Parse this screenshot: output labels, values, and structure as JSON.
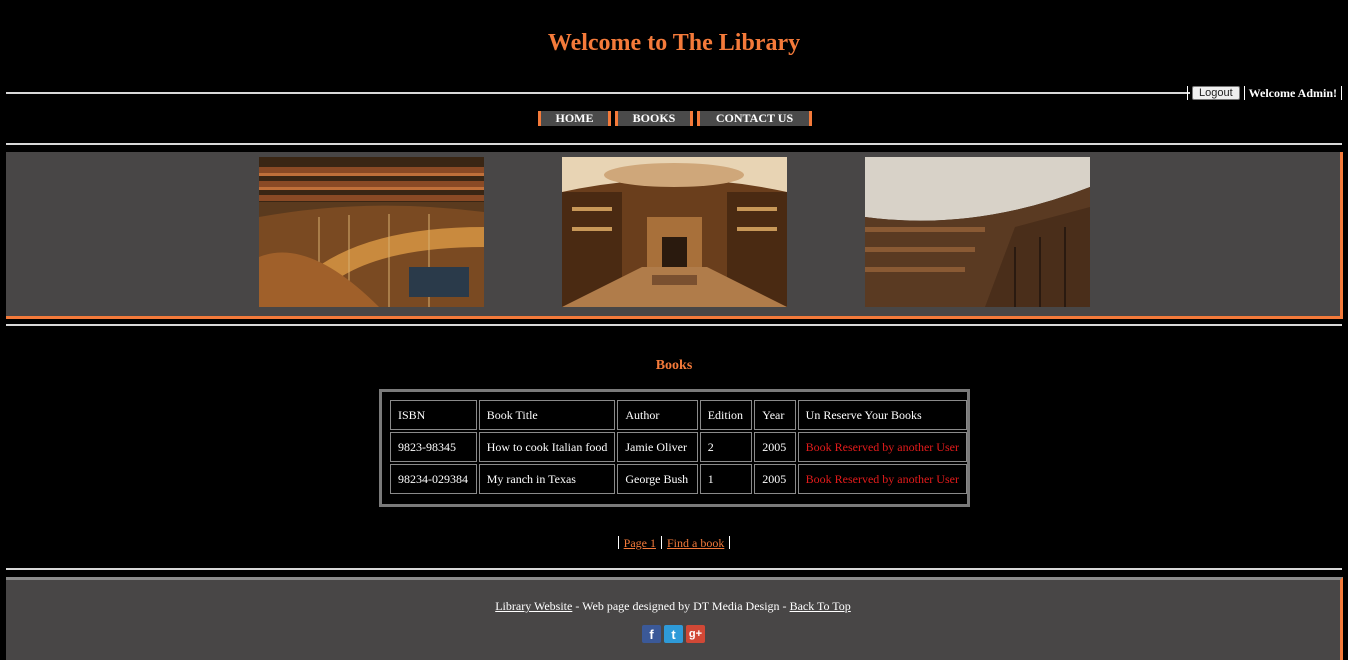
{
  "header": {
    "title": "Welcome to The Library",
    "logout_label": "Logout",
    "welcome_text": "Welcome Admin!"
  },
  "nav": {
    "items": [
      {
        "label": "HOME"
      },
      {
        "label": "BOOKS"
      },
      {
        "label": "CONTACT US"
      }
    ]
  },
  "main": {
    "heading": "Books",
    "table": {
      "headers": [
        "ISBN",
        "Book Title",
        "Author",
        "Edition",
        "Year",
        "Un Reserve Your Books"
      ],
      "rows": [
        [
          "9823-98345",
          "How to cook Italian food",
          "Jamie Oliver",
          "2",
          "2005",
          "Book Reserved by another User"
        ],
        [
          "98234-029384",
          "My ranch in Texas",
          "George Bush",
          "1",
          "2005",
          "Book Reserved by another User"
        ]
      ]
    },
    "pager": {
      "page_link": "Page 1",
      "find_link": "Find a book"
    }
  },
  "footer": {
    "site_link": "Library Website",
    "designed_by": " - Web page designed by DT Media Design - ",
    "back_to_top": "Back To Top",
    "social": [
      {
        "icon": "facebook-icon",
        "glyph": "f",
        "color": "#3b5998"
      },
      {
        "icon": "twitter-icon",
        "glyph": "t",
        "color": "#2e9ad8"
      },
      {
        "icon": "google-plus-icon",
        "glyph": "g+",
        "color": "#d14836"
      }
    ]
  },
  "colors": {
    "accent": "#f47a3a",
    "panel": "#484646",
    "reserved": "#e31b1b"
  }
}
